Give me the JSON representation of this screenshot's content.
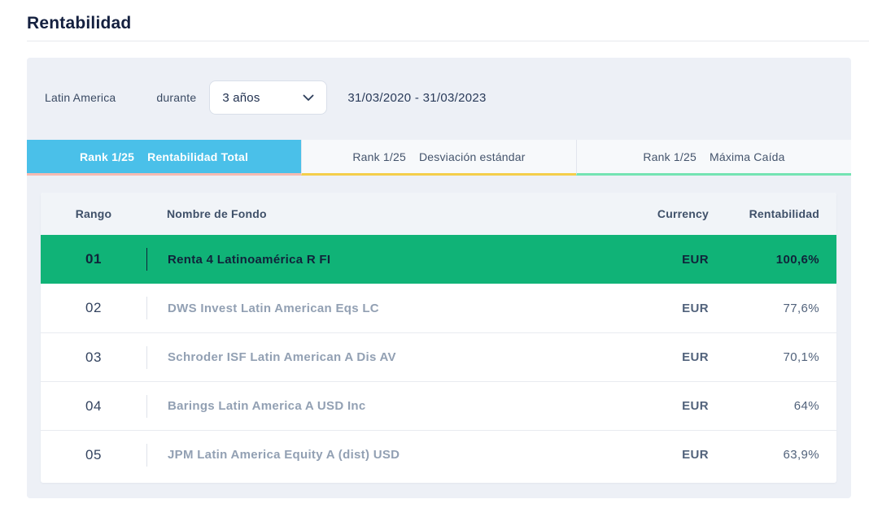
{
  "page": {
    "title": "Rentabilidad"
  },
  "filters": {
    "region": "Latin America",
    "durante_label": "durante",
    "period_selected": "3 años",
    "date_range": "31/03/2020 - 31/03/2023"
  },
  "tabs": [
    {
      "rank": "Rank 1/25",
      "label": "Rentabilidad Total",
      "active": true,
      "underline_color": "#f6bab1"
    },
    {
      "rank": "Rank 1/25",
      "label": "Desviación estándar",
      "active": false,
      "underline_color": "#f4ce4a"
    },
    {
      "rank": "Rank 1/25",
      "label": "Máxima Caída",
      "active": false,
      "underline_color": "#74e4b3"
    }
  ],
  "table": {
    "columns": [
      "Rango",
      "Nombre de Fondo",
      "Currency",
      "Rentabilidad"
    ],
    "rows": [
      {
        "rank": "01",
        "name": "Renta 4 Latinoamérica R FI",
        "currency": "EUR",
        "value": "100,6%",
        "highlighted": true
      },
      {
        "rank": "02",
        "name": "DWS Invest Latin American Eqs LC",
        "currency": "EUR",
        "value": "77,6%",
        "highlighted": false
      },
      {
        "rank": "03",
        "name": "Schroder ISF Latin American A Dis AV",
        "currency": "EUR",
        "value": "70,1%",
        "highlighted": false
      },
      {
        "rank": "04",
        "name": "Barings Latin America A USD Inc",
        "currency": "EUR",
        "value": "64%",
        "highlighted": false
      },
      {
        "rank": "05",
        "name": "JPM Latin America Equity A (dist) USD",
        "currency": "EUR",
        "value": "63,9%",
        "highlighted": false
      }
    ]
  },
  "colors": {
    "active_tab_bg": "#4ac0e9",
    "highlight_row_bg": "#10b377",
    "panel_bg": "#edf0f6"
  }
}
